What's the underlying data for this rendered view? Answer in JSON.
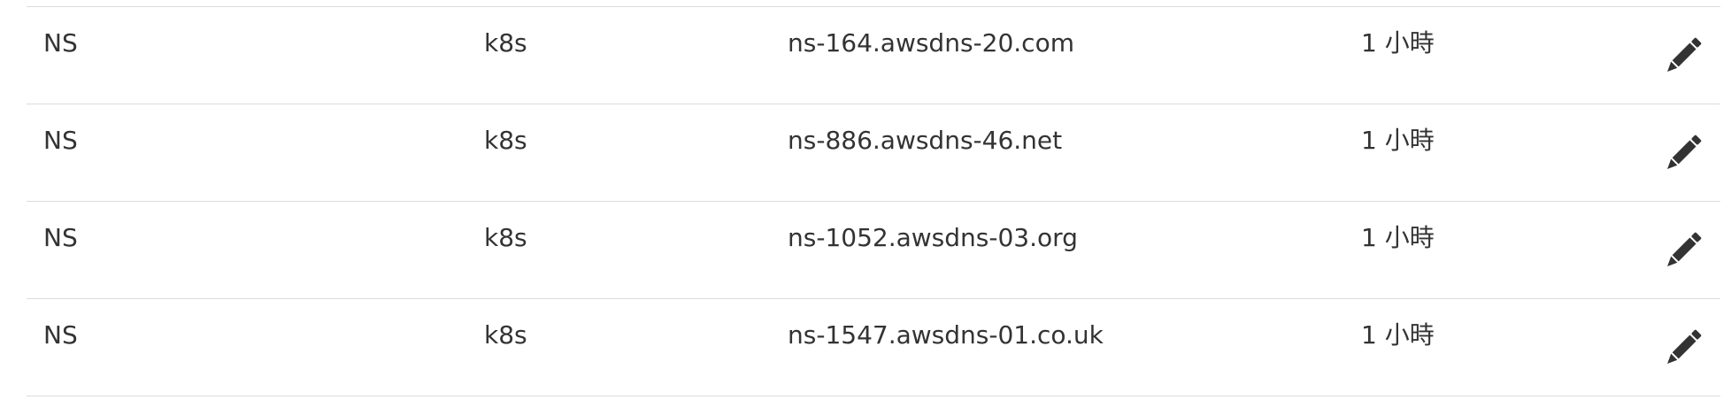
{
  "records": [
    {
      "type": "NS",
      "name": "k8s",
      "value": "ns-164.awsdns-20.com",
      "ttl": "1 小時",
      "action_icon": "pencil-icon"
    },
    {
      "type": "NS",
      "name": "k8s",
      "value": "ns-886.awsdns-46.net",
      "ttl": "1 小時",
      "action_icon": "pencil-icon"
    },
    {
      "type": "NS",
      "name": "k8s",
      "value": "ns-1052.awsdns-03.org",
      "ttl": "1 小時",
      "action_icon": "pencil-icon"
    },
    {
      "type": "NS",
      "name": "k8s",
      "value": "ns-1547.awsdns-01.co.uk",
      "ttl": "1 小時",
      "action_icon": "pencil-icon"
    }
  ],
  "colors": {
    "text": "#333333",
    "divider": "#dcdcdc",
    "icon": "#333333"
  }
}
